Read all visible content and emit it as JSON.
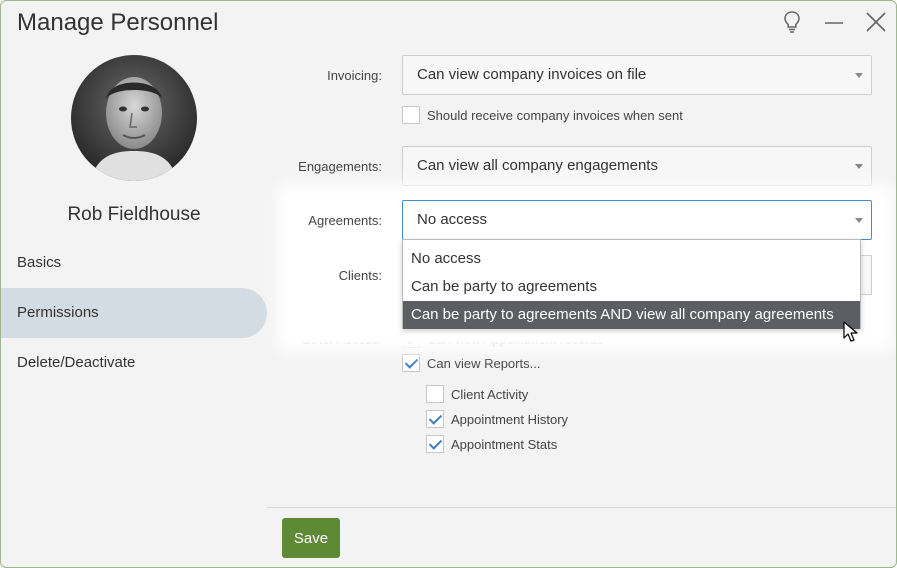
{
  "window": {
    "title": "Manage Personnel",
    "icons": [
      "lightbulb-icon",
      "minimize-icon",
      "close-icon"
    ]
  },
  "profile": {
    "name": "Rob Fieldhouse"
  },
  "nav": {
    "items": [
      {
        "label": "Basics",
        "active": false
      },
      {
        "label": "Permissions",
        "active": true
      },
      {
        "label": "Delete/Deactivate",
        "active": false
      }
    ]
  },
  "permissions": {
    "invoicing": {
      "label": "Invoicing:",
      "value": "Can view company invoices on file",
      "checkbox_label": "Should receive company invoices when sent",
      "checkbox_checked": false
    },
    "engagements": {
      "label": "Engagements:",
      "value": "Can view all company engagements"
    },
    "agreements": {
      "label": "Agreements:",
      "value": "No access",
      "options": [
        "No access",
        "Can be party to agreements",
        "Can be party to agreements AND view all company agreements"
      ],
      "highlighted_index": 2
    },
    "clients": {
      "label": "Clients:"
    },
    "other_access": {
      "label": "Other Access:",
      "items": [
        {
          "label": "Can view Appointment records",
          "checked": true
        },
        {
          "label": "Can view Reports...",
          "checked": true
        }
      ],
      "report_items": [
        {
          "label": "Client Activity",
          "checked": false
        },
        {
          "label": "Appointment History",
          "checked": true
        },
        {
          "label": "Appointment Stats",
          "checked": true
        }
      ]
    }
  },
  "footer": {
    "save_label": "Save",
    "save_color": "#5e8a36"
  },
  "colors": {
    "accent": "#3f90d2",
    "nav_active_bg": "#d3dce2",
    "dropdown_highlight": "#5d5e63"
  }
}
